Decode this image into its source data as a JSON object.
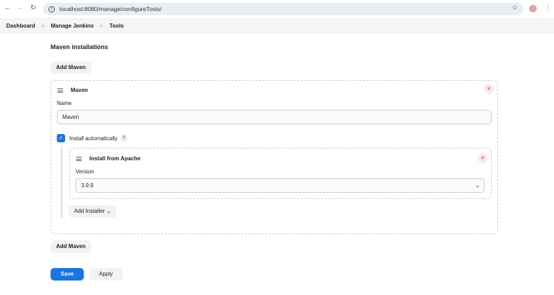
{
  "browser": {
    "url": "localhost:8080/manage/configureTools/"
  },
  "breadcrumb": [
    "Dashboard",
    "Manage Jenkins",
    "Tools"
  ],
  "section_title": "Maven installations",
  "add_maven_label": "Add Maven",
  "maven": {
    "title": "Maven",
    "name_label": "Name",
    "name_value": "Maven",
    "install_auto_label": "Install automatically",
    "help": "?",
    "installer": {
      "title": "Install from Apache",
      "version_label": "Version",
      "version_value": "3.9.9"
    },
    "add_installer_label": "Add Installer"
  },
  "save_label": "Save",
  "apply_label": "Apply"
}
